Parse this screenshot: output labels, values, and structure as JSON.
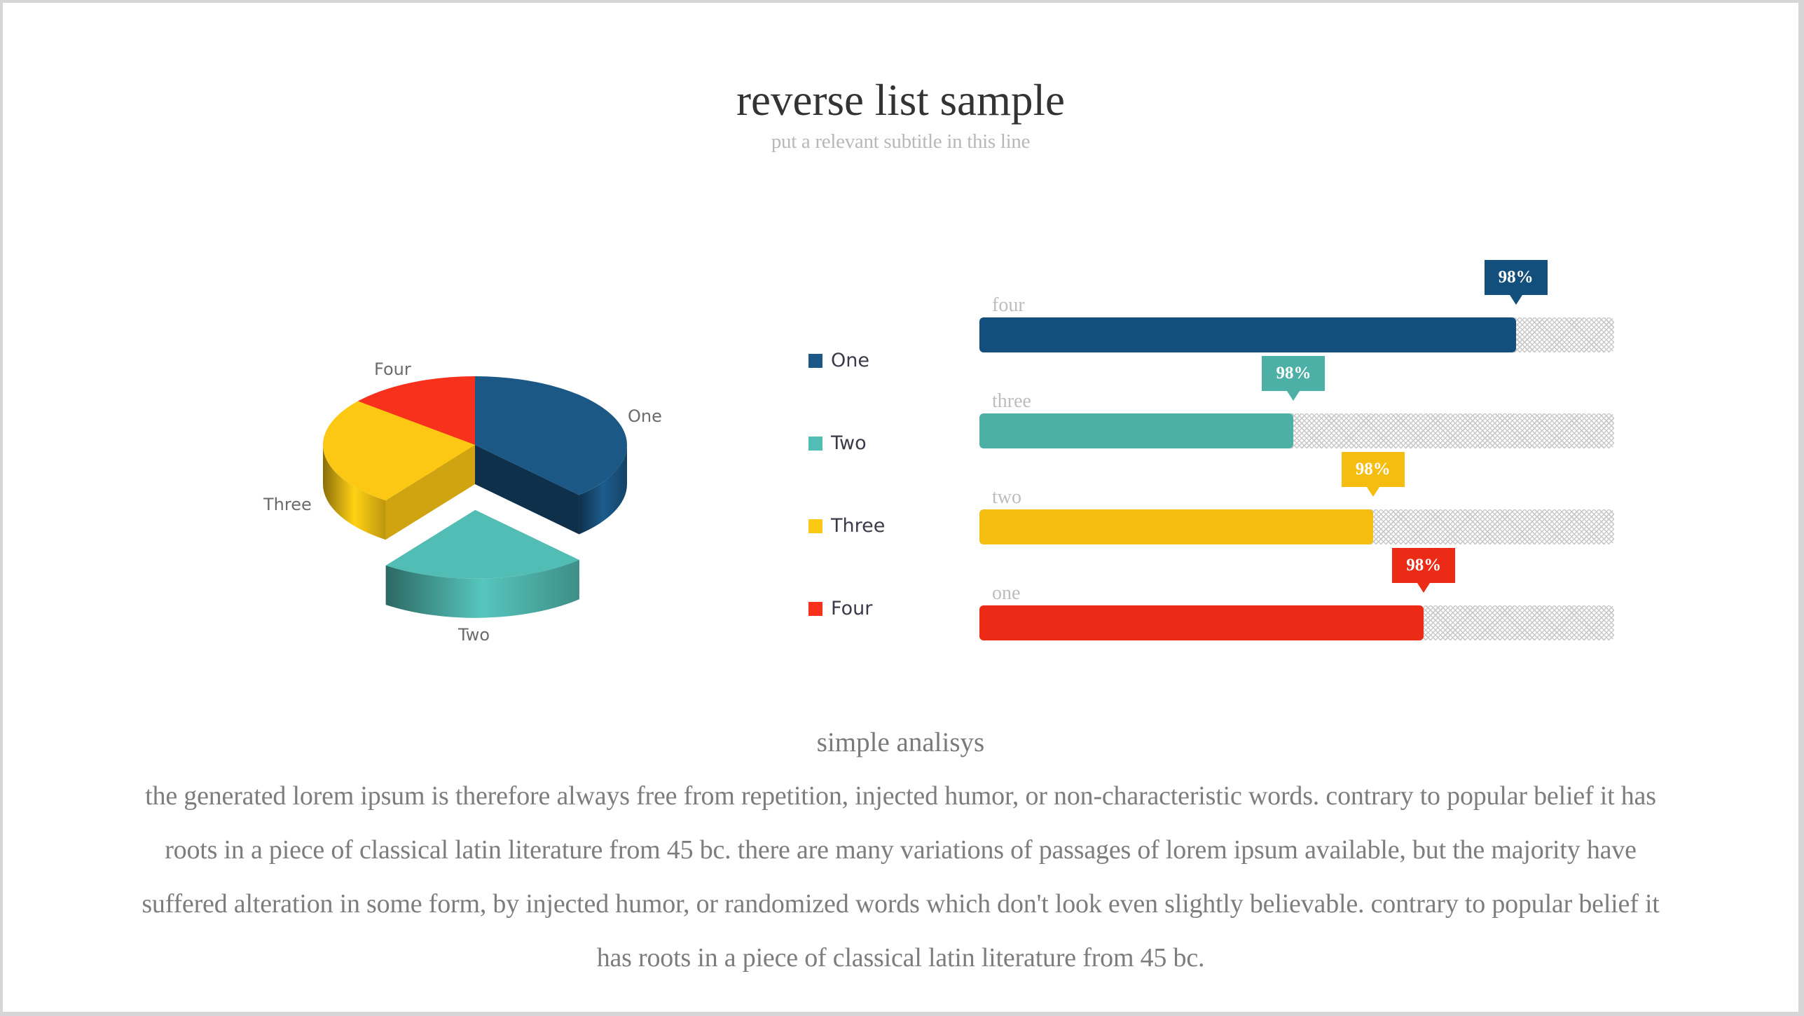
{
  "header": {
    "title": "reverse list sample",
    "subtitle": "put a relevant subtitle in this line"
  },
  "chart_data": [
    {
      "type": "pie",
      "style": "3d-exploded",
      "title": "",
      "categories": [
        "One",
        "Two",
        "Three",
        "Four"
      ],
      "values": [
        38,
        22,
        26,
        14
      ],
      "colors": [
        "#1b5886",
        "#52bdb4",
        "#fcc813",
        "#f8311c"
      ],
      "exploded": [
        "Two"
      ],
      "legend": {
        "placement": "right",
        "entries": [
          {
            "label": "One",
            "color": "#1b5886"
          },
          {
            "label": "Two",
            "color": "#52bdb4"
          },
          {
            "label": "Three",
            "color": "#fcc813"
          },
          {
            "label": "Four",
            "color": "#f8311c"
          }
        ]
      }
    },
    {
      "type": "bar",
      "orientation": "horizontal",
      "title": "",
      "xlim": [
        0,
        100
      ],
      "categories": [
        "four",
        "three",
        "two",
        "one"
      ],
      "values": [
        84.5,
        49.5,
        62,
        70
      ],
      "data_labels": [
        "98%",
        "98%",
        "98%",
        "98%"
      ],
      "colors": [
        "#134f7c",
        "#4cb0a7",
        "#f4bd10",
        "#ec2b16"
      ]
    }
  ],
  "analysis": {
    "heading": "simple analisys",
    "body": "the generated lorem ipsum is therefore always free from repetition, injected humor, or non-characteristic words. contrary to popular belief it has roots in a piece of classical latin literature from 45 bc. there are many variations of passages of lorem ipsum available, but the majority have suffered alteration in some form, by injected humor, or randomized words which don't look even slightly believable. contrary to popular belief it has roots in a piece of classical latin literature from 45 bc."
  }
}
